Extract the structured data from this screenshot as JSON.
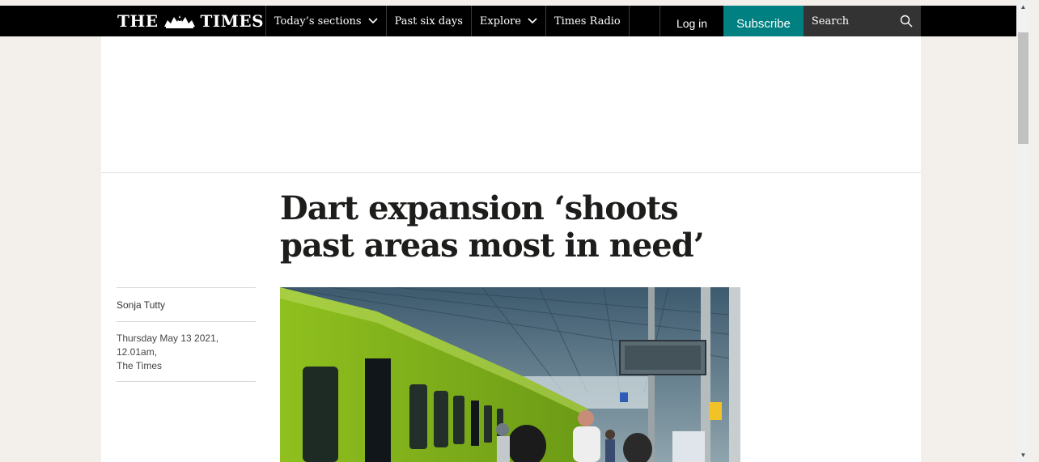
{
  "header": {
    "logo_left": "THE",
    "logo_right": "TIMES",
    "nav": [
      {
        "label": "Today’s sections",
        "has_dropdown": true
      },
      {
        "label": "Past six days",
        "has_dropdown": false
      },
      {
        "label": "Explore",
        "has_dropdown": true
      },
      {
        "label": "Times Radio",
        "has_dropdown": false
      }
    ],
    "login_label": "Log in",
    "subscribe_label": "Subscribe",
    "search_label": "Search"
  },
  "article": {
    "headline": "Dart expansion ‘shoots past areas most in need’",
    "author": "Sonja Tutty",
    "date": "Thursday May 13 2021, 12.01am,",
    "publication": "The Times"
  },
  "icons": {
    "logo_crest": "royal-crest-icon",
    "search": "search-icon",
    "dropdown": "chevron-down-icon"
  },
  "colors": {
    "topbar": "#000000",
    "subscribe": "#008080",
    "search_bg": "#333333",
    "page_bg": "#f3efeb"
  }
}
